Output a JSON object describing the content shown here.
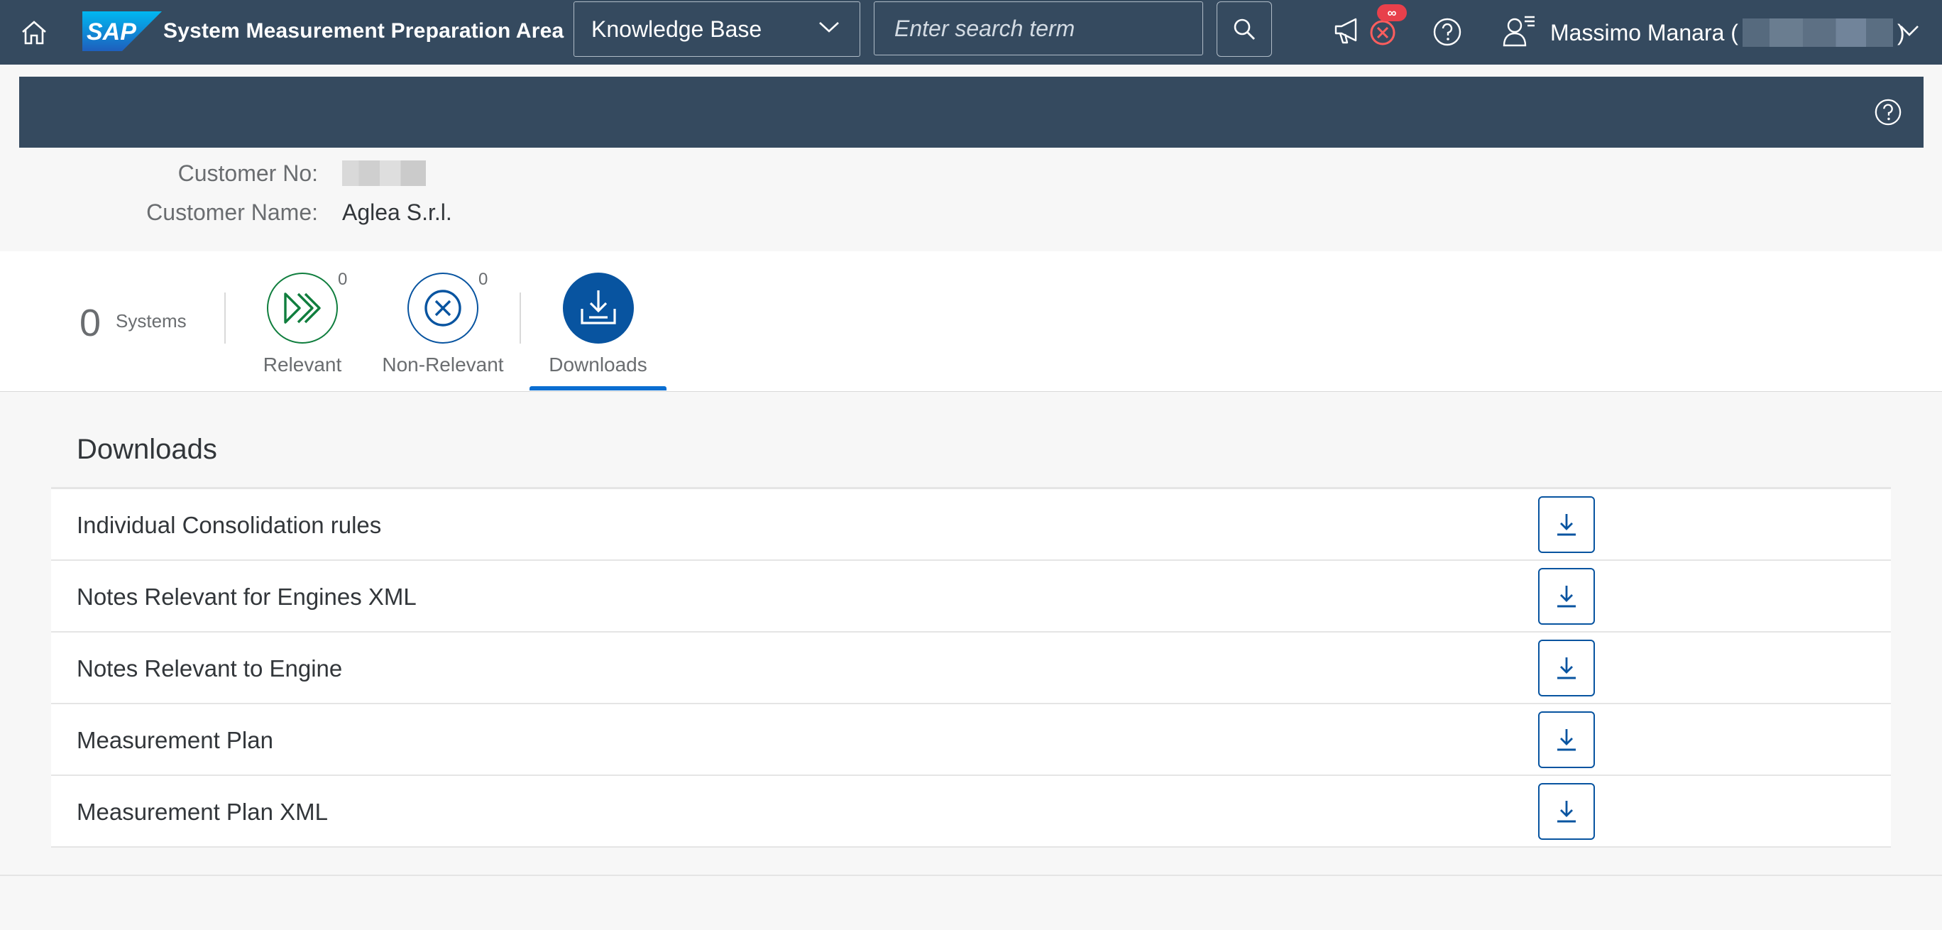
{
  "shell": {
    "logo_text": "SAP",
    "app_title": "System Measurement Preparation Area",
    "knowledge_select": "Knowledge Base",
    "search_placeholder": "Enter search term",
    "error_badge": "∞",
    "user_name_prefix": "Massimo Manara (",
    "user_name_suffix": ")"
  },
  "customer": {
    "number_label": "Customer No:",
    "name_label": "Customer Name:",
    "name_value": "Aglea S.r.l."
  },
  "tabs": {
    "systems_count": "0",
    "systems_label": "Systems",
    "relevant": {
      "label": "Relevant",
      "count": "0"
    },
    "non_relevant": {
      "label": "Non-Relevant",
      "count": "0"
    },
    "downloads": {
      "label": "Downloads"
    }
  },
  "downloads": {
    "title": "Downloads",
    "items": [
      {
        "label": "Individual Consolidation rules"
      },
      {
        "label": "Notes Relevant for Engines XML"
      },
      {
        "label": "Notes Relevant to Engine"
      },
      {
        "label": "Measurement Plan"
      },
      {
        "label": "Measurement Plan XML"
      }
    ]
  },
  "colors": {
    "shell": "#354a5f",
    "accent": "#0a6ed1",
    "positive": "#107e3e",
    "brand_blue": "#0854a0",
    "badge": "#e8404b"
  }
}
